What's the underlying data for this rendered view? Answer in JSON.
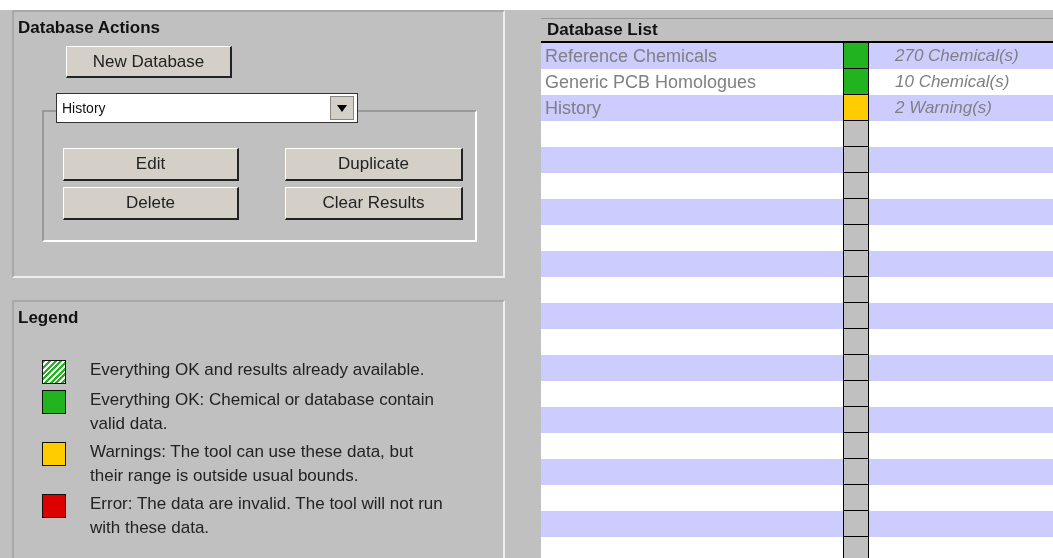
{
  "actions": {
    "title": "Database Actions",
    "new_button": "New Database",
    "dropdown": {
      "value": "History"
    },
    "buttons": [
      "Edit",
      "Duplicate",
      "Delete",
      "Clear Results"
    ]
  },
  "legend": {
    "title": "Legend",
    "items": [
      {
        "kind": "hatched",
        "color": "#22b41e",
        "text": "Everything OK and results already available."
      },
      {
        "kind": "solid",
        "color": "#22b41e",
        "text": "Everything OK: Chemical or database contain valid data."
      },
      {
        "kind": "solid",
        "color": "#ffcc00",
        "text": "Warnings: The tool can use these data, but their range is outside usual bounds."
      },
      {
        "kind": "solid",
        "color": "#dd0000",
        "text": "Error: The data are invalid. The tool will not run with these data."
      }
    ]
  },
  "database_list": {
    "title": "Database List",
    "rows": [
      {
        "name": "Reference Chemicals",
        "color": "#22b41e",
        "count": "270 Chemical(s)"
      },
      {
        "name": "Generic PCB Homologues",
        "color": "#22b41e",
        "count": "10 Chemical(s)"
      },
      {
        "name": "History",
        "color": "#ffcc00",
        "count": "2 Warning(s)"
      }
    ]
  }
}
